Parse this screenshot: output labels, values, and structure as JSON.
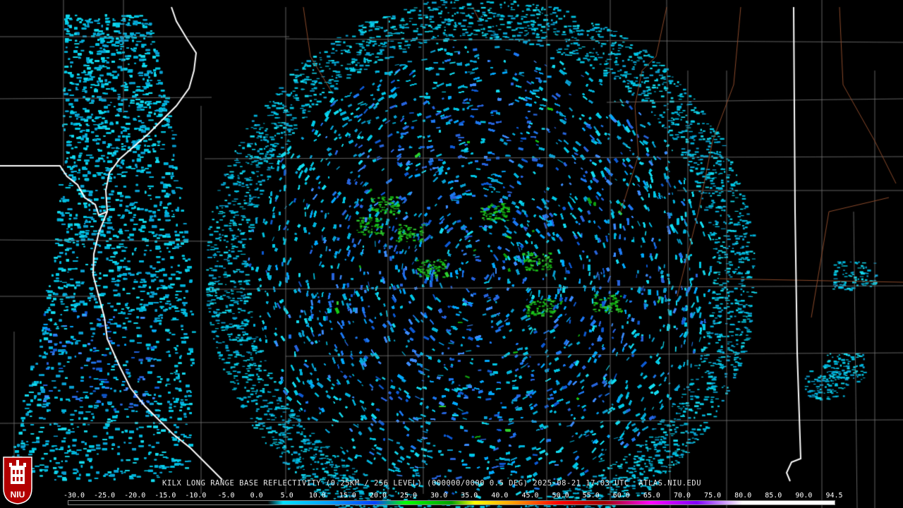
{
  "product": {
    "title": "KILX LONG RANGE BASE REFLECTIVITY (0.25KM / 256 LEVEL) (000000/0000 0.5 DEG) 2025-08-21 17:03 UTC  ATLAS.NIU.EDU"
  },
  "logo": {
    "text": "NIU",
    "icon": "niu-huskie-tower-icon"
  },
  "colorscale": {
    "labels": [
      "-30.0",
      "-25.0",
      "-20.0",
      "-15.0",
      "-10.0",
      "-5.0",
      "0.0",
      "5.0",
      "10.0",
      "15.0",
      "20.0",
      "25.0",
      "30.0",
      "35.0",
      "40.0",
      "45.0",
      "50.0",
      "55.0",
      "60.0",
      "65.0",
      "70.0",
      "75.0",
      "80.0",
      "85.0",
      "90.0",
      "94.5"
    ],
    "colors": {
      "background": "#000000",
      "county_lines": "#7a7a7a",
      "state_lines": "#ffffff",
      "highways": "#8b4a2b",
      "echo_light": "#00c8e6",
      "echo_medium": "#1e78f0",
      "echo_green": "#18c818"
    }
  }
}
